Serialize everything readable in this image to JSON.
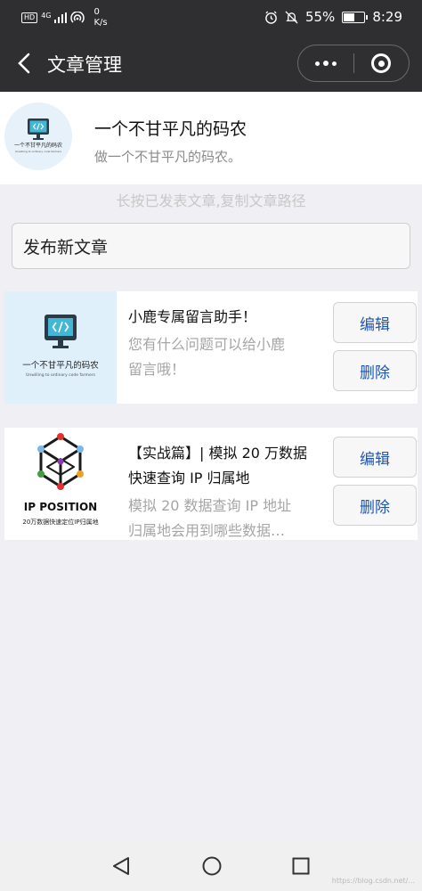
{
  "status_bar": {
    "network": "HD",
    "signal_gen": "4G",
    "speed_value": "0",
    "speed_unit": "K/s",
    "battery": "55%",
    "battery_level": 0.55,
    "time": "8:29"
  },
  "navbar": {
    "title": "文章管理"
  },
  "profile": {
    "name": "一个不甘平凡的码农",
    "description": "做一个不甘平凡的码农。",
    "avatar_caption": "一个不甘平凡的码农",
    "avatar_subcaption": "Unwilling to ordinary code farmers"
  },
  "hint": "长按已发表文章,复制文章路径",
  "publish_button": "发布新文章",
  "articles": [
    {
      "title": "小鹿专属留言助手！",
      "description_lines": [
        "您有什么问题可以给小鹿",
        "留言哦！"
      ],
      "thumb_caption": "一个不甘平凡的码农",
      "thumb_subcaption": "Unwilling to ordinary code farmers",
      "edit_label": "编辑",
      "delete_label": "删除"
    },
    {
      "title_lines": [
        "【实战篇】| 模拟 20 万数据",
        "快速查询 IP 归属地"
      ],
      "description_lines": [
        "模拟 20 数据查询 IP 地址",
        "归属地会用到哪些数据…"
      ],
      "thumb_caption": "IP POSITION",
      "thumb_subcaption": "20万数据快速定位IP归属地",
      "edit_label": "编辑",
      "delete_label": "删除"
    }
  ],
  "watermark": "https://blog.csdn.net/..."
}
